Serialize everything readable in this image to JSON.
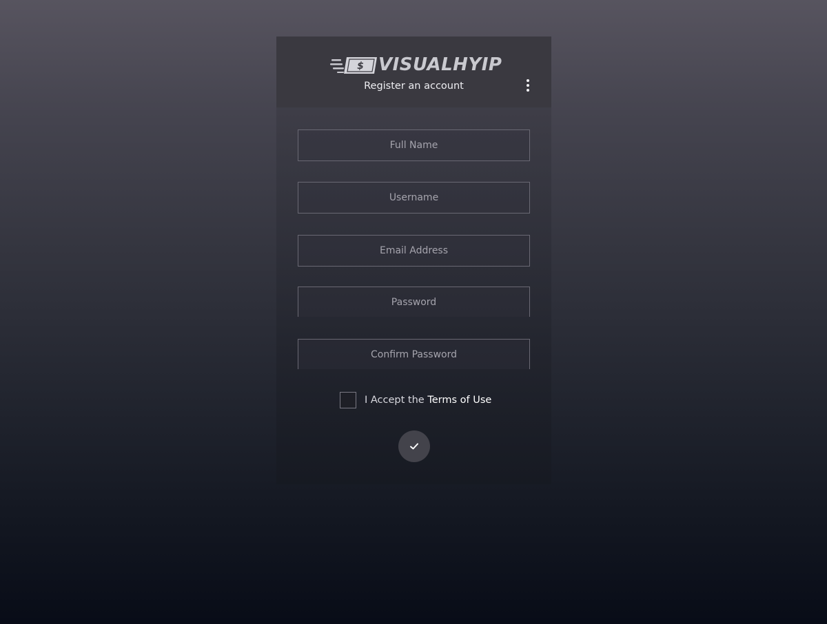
{
  "brand": {
    "name": "VISUALHYIP",
    "logo_icon": "dollar-bill-icon",
    "logo_glyph": "$"
  },
  "header": {
    "subtitle": "Register an account",
    "menu_icon": "more-vertical-icon"
  },
  "form": {
    "fields": [
      {
        "name": "full-name",
        "placeholder": "Full Name",
        "type": "text",
        "value": ""
      },
      {
        "name": "username",
        "placeholder": "Username",
        "type": "text",
        "value": ""
      },
      {
        "name": "email",
        "placeholder": "Email Address",
        "type": "email",
        "value": ""
      },
      {
        "name": "password",
        "placeholder": "Password",
        "type": "password",
        "value": ""
      },
      {
        "name": "confirm-password",
        "placeholder": "Confirm Password",
        "type": "password",
        "value": ""
      }
    ],
    "terms": {
      "prefix": "I Accept the",
      "link": "Terms of Use",
      "checked": false
    },
    "submit_icon": "checkmark-icon"
  },
  "colors": {
    "header_bg": "#3a3940",
    "accent_text": "#ffffff",
    "field_border": "#6a6974"
  }
}
